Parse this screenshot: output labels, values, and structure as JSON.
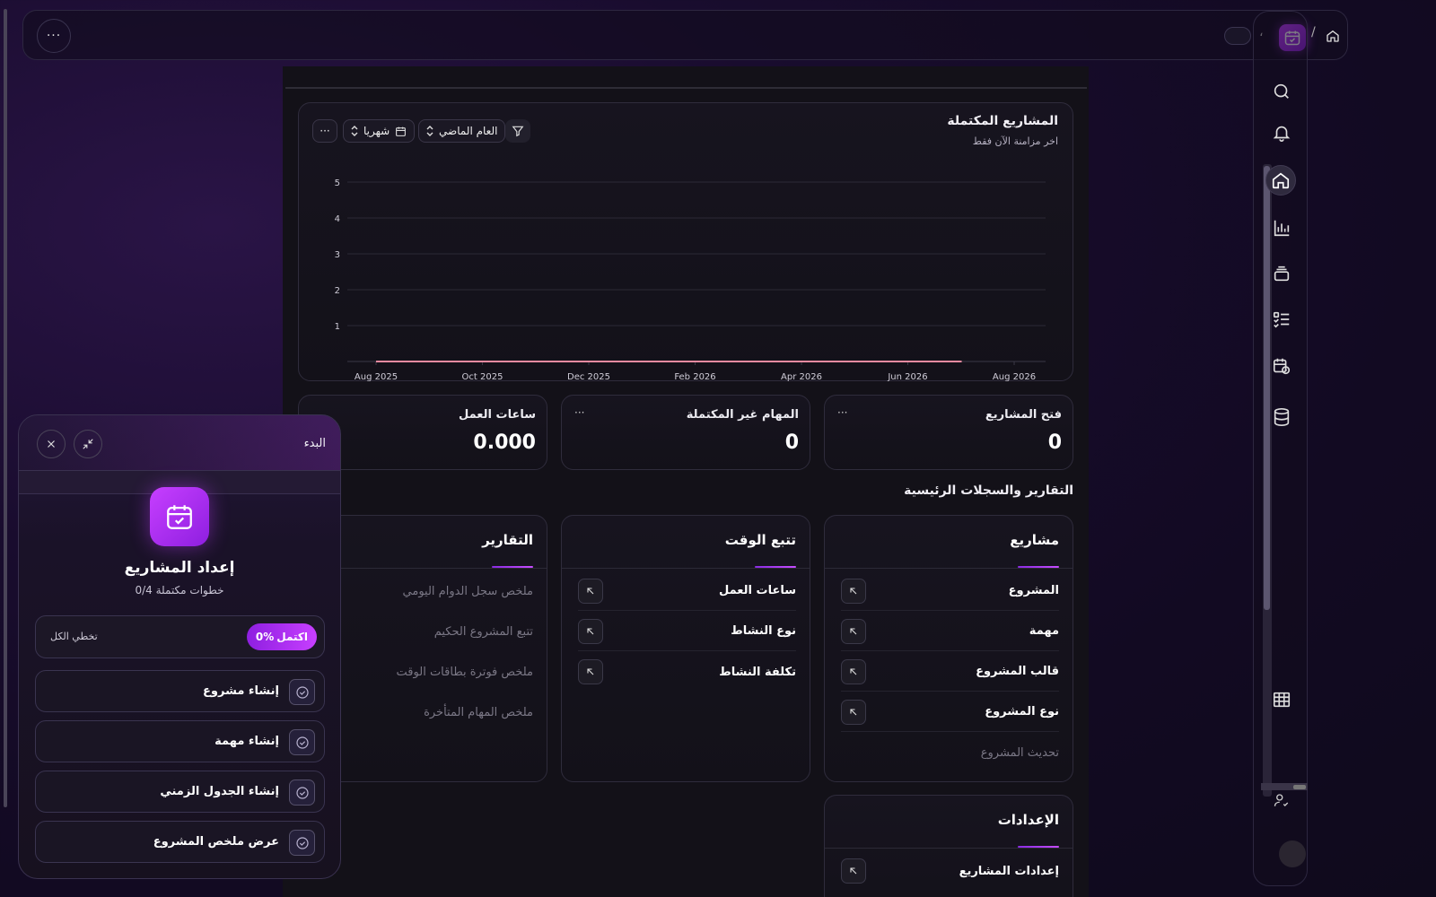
{
  "topbar": {
    "more_label": "···",
    "separator_comma": "،",
    "breadcrumb_separator": "/"
  },
  "chart_card": {
    "title": "المشاريع المكتملة",
    "subtitle": "اخر مزامنة الآن فقط",
    "range_select": "العام الماضي",
    "interval_select": "شهريا",
    "more_label": "···"
  },
  "chart_data": {
    "type": "line",
    "x": [
      "Aug 2025",
      "Oct 2025",
      "Dec 2025",
      "Feb 2026",
      "Apr 2026",
      "Jun 2026",
      "Aug 2026"
    ],
    "series": [
      {
        "values": [
          0,
          0,
          0,
          0,
          0,
          0
        ]
      }
    ],
    "series_x": [
      "Aug 2025",
      "Oct 2025",
      "Dec 2025",
      "Feb 2026",
      "Apr 2026",
      "Jun 2026"
    ],
    "yticks": [
      "1",
      "2",
      "3",
      "4",
      "5"
    ],
    "ylim": [
      0,
      5
    ],
    "grid": true,
    "line_color": "#f08aa0"
  },
  "stats": [
    {
      "label": "فتح المشاريع",
      "value": "0",
      "more": "···"
    },
    {
      "label": "المهام غير المكتملة",
      "value": "0",
      "more": "···"
    },
    {
      "label": "ساعات العمل",
      "value": "0.000"
    }
  ],
  "section_title": "التقارير والسجلات الرئيسية",
  "cards": {
    "projects": {
      "title": "مشاريع",
      "rows": [
        "المشروع",
        "مهمة",
        "قالب المشروع",
        "نوع المشروع"
      ],
      "muted_row": "تحديث المشروع"
    },
    "time_tracking": {
      "title": "تتبع الوقت",
      "rows": [
        "ساعات العمل",
        "نوع النشاط",
        "تكلفة النشاط"
      ]
    },
    "reports": {
      "title": "التقارير",
      "rows": [
        "ملخص سجل الدوام اليومي",
        "تتبع المشروع الحكيم",
        "ملخص فوترة بطاقات الوقت",
        "ملخص المهام المتأخرة"
      ]
    },
    "settings": {
      "title": "الإعدادات",
      "rows": [
        "إعدادات المشاريع"
      ]
    }
  },
  "getting_started": {
    "title": "البدء",
    "heading": "إعداد المشاريع",
    "progress_text": "0/4 خطوات مكتملة",
    "progress": 0,
    "pct_value": "0%",
    "pct_word": "اكتمل",
    "skip_label": "تخطي الكل",
    "steps": [
      "إنشاء مشروع",
      "إنشاء مهمة",
      "إنشاء الجدول الزمني",
      "عرض ملخص المشروع"
    ]
  },
  "colors": {
    "accent": "#b53cff",
    "accent_dark": "#8a1fd8",
    "panel_bg": "#131118"
  }
}
